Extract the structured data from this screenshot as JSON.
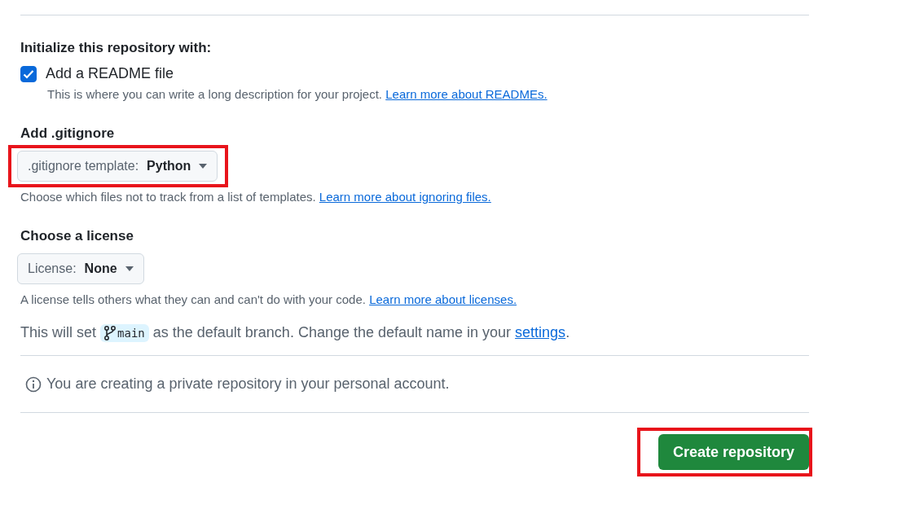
{
  "initialize": {
    "heading": "Initialize this repository with:",
    "readme": {
      "label": "Add a README file",
      "checked": true,
      "description": "This is where you can write a long description for your project.",
      "link": "Learn more about READMEs."
    }
  },
  "gitignore": {
    "heading": "Add .gitignore",
    "dropdown": {
      "label": ".gitignore template:",
      "value": "Python",
      "highlighted": true
    },
    "description": "Choose which files not to track from a list of templates.",
    "link": "Learn more about ignoring files."
  },
  "license": {
    "heading": "Choose a license",
    "dropdown": {
      "label": "License:",
      "value": "None",
      "highlighted": false
    },
    "description": "A license tells others what they can and can't do with your code.",
    "link": "Learn more about licenses."
  },
  "branch": {
    "before": "This will set",
    "branch": "main",
    "after": "as the default branch. Change the default name in your",
    "link": "settings",
    "end": "."
  },
  "notice": "You are creating a private repository in your personal account.",
  "submit": {
    "label": "Create repository",
    "highlighted": true
  }
}
